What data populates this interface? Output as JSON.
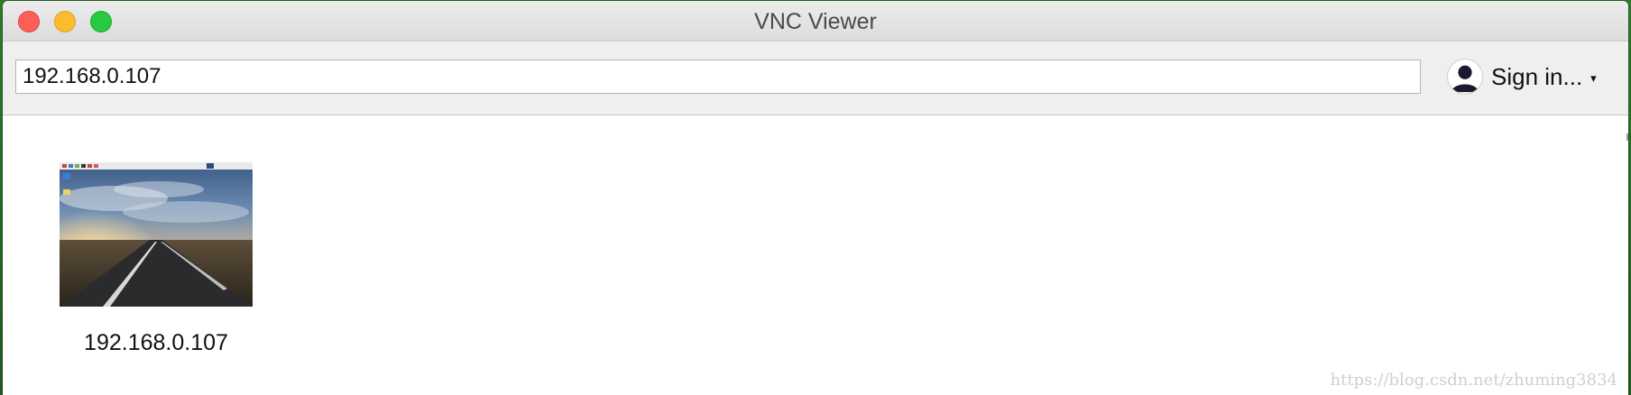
{
  "window": {
    "title": "VNC Viewer",
    "controls": {
      "close_color": "#fc5f57",
      "minimize_color": "#fdbc2e",
      "zoom_color": "#28c840"
    }
  },
  "toolbar": {
    "address_value": "192.168.0.107",
    "sign_in_label": "Sign in...",
    "sign_in_chevron": "▾",
    "avatar_icon": "user-avatar-icon"
  },
  "connections": [
    {
      "label": "192.168.0.107",
      "thumbnail": "desktop-preview"
    }
  ],
  "watermark": "https://blog.csdn.net/zhuming3834"
}
